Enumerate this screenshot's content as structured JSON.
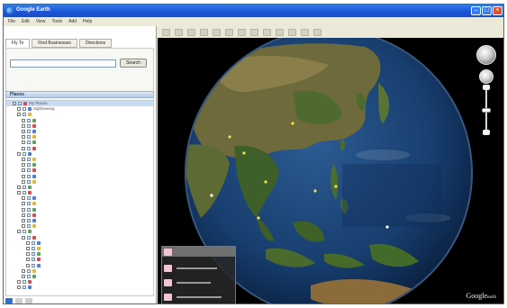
{
  "window": {
    "title": "Google Earth",
    "title_right_label": ""
  },
  "window_buttons": {
    "minimize": "–",
    "maximize": "□",
    "close": "×"
  },
  "menu": [
    "File",
    "Edit",
    "View",
    "Tools",
    "Add",
    "Help"
  ],
  "search": {
    "tabs": [
      "Fly To",
      "Find Businesses",
      "Directions"
    ],
    "input_value": "",
    "button": "Search"
  },
  "places": {
    "header": "Places"
  },
  "tree_rows": [
    {
      "text": "My Places",
      "indent": 1,
      "kind": "plain"
    },
    {
      "text": "Sightseeing",
      "indent": 2,
      "kind": "plain"
    },
    {
      "text": "",
      "indent": 2,
      "kind": "plain"
    },
    {
      "text": "",
      "indent": 3,
      "kind": "link"
    },
    {
      "text": "",
      "indent": 3,
      "kind": "link"
    },
    {
      "text": "",
      "indent": 3,
      "kind": "link"
    },
    {
      "text": "",
      "indent": 3,
      "kind": "link"
    },
    {
      "text": "",
      "indent": 3,
      "kind": "link"
    },
    {
      "text": "",
      "indent": 3,
      "kind": "link"
    },
    {
      "text": "",
      "indent": 2,
      "kind": "plain"
    },
    {
      "text": "",
      "indent": 3,
      "kind": "link"
    },
    {
      "text": "",
      "indent": 3,
      "kind": "plain"
    },
    {
      "text": "",
      "indent": 3,
      "kind": "plain"
    },
    {
      "text": "",
      "indent": 3,
      "kind": "plain"
    },
    {
      "text": "",
      "indent": 3,
      "kind": "link"
    },
    {
      "text": "",
      "indent": 2,
      "kind": "plain"
    },
    {
      "text": "",
      "indent": 2,
      "kind": "plain"
    },
    {
      "text": "",
      "indent": 3,
      "kind": "plain"
    },
    {
      "text": "",
      "indent": 3,
      "kind": "link"
    },
    {
      "text": "",
      "indent": 3,
      "kind": "plain"
    },
    {
      "text": "",
      "indent": 3,
      "kind": "plain"
    },
    {
      "text": "",
      "indent": 3,
      "kind": "plain"
    },
    {
      "text": "",
      "indent": 3,
      "kind": "plain"
    },
    {
      "text": "",
      "indent": 2,
      "kind": "plain"
    },
    {
      "text": "",
      "indent": 3,
      "kind": "plain"
    },
    {
      "text": "",
      "indent": 4,
      "kind": "plain"
    },
    {
      "text": "",
      "indent": 4,
      "kind": "link"
    },
    {
      "text": "",
      "indent": 4,
      "kind": "link"
    },
    {
      "text": "",
      "indent": 4,
      "kind": "link"
    },
    {
      "text": "",
      "indent": 4,
      "kind": "link"
    },
    {
      "text": "",
      "indent": 3,
      "kind": "plain"
    },
    {
      "text": "",
      "indent": 3,
      "kind": "plain"
    },
    {
      "text": "",
      "indent": 2,
      "kind": "plain"
    },
    {
      "text": "",
      "indent": 2,
      "kind": "plain"
    }
  ],
  "popup": {
    "title": ""
  },
  "watermark": {
    "brand": "Google",
    "sub": "earth"
  },
  "colors": {
    "titlebar": "#1b55d6",
    "link": "#2233cc",
    "selected_row": "#c9dcf5",
    "space": "#000000",
    "ocean": "#173e6e"
  }
}
